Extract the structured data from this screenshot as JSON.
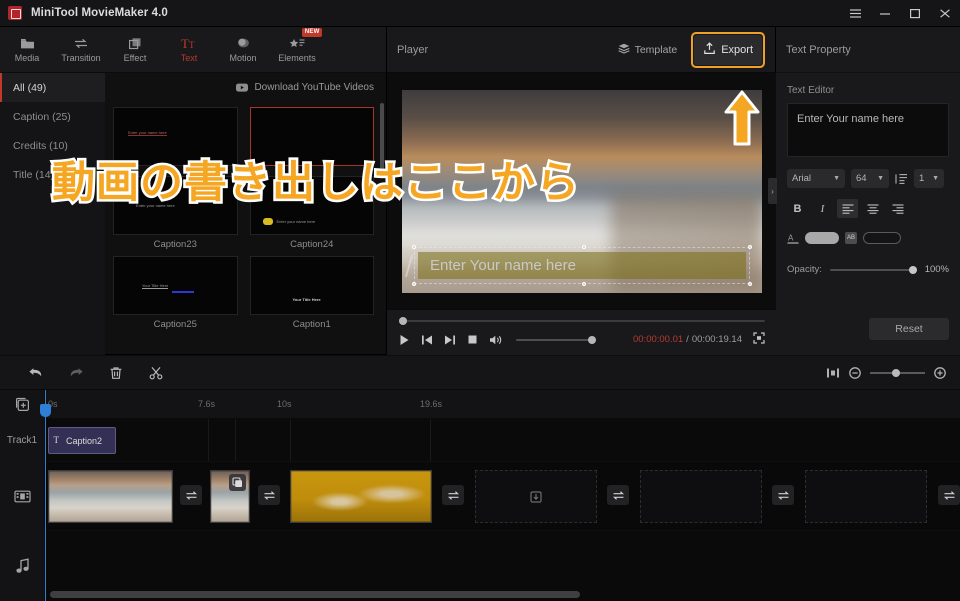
{
  "window": {
    "title": "MiniTool MovieMaker 4.0",
    "logo_icon": "app-logo-icon",
    "menu_icon": "hamburger-menu-icon",
    "minimize_icon": "minimize-icon",
    "maximize_icon": "maximize-icon",
    "close_icon": "close-icon"
  },
  "toolbar": {
    "items": [
      {
        "label": "Media",
        "icon": "media-folder-icon",
        "active": false,
        "badge": ""
      },
      {
        "label": "Transition",
        "icon": "transition-icon",
        "active": false,
        "badge": ""
      },
      {
        "label": "Effect",
        "icon": "effect-icon",
        "active": false,
        "badge": ""
      },
      {
        "label": "Text",
        "icon": "text-icon",
        "active": true,
        "badge": ""
      },
      {
        "label": "Motion",
        "icon": "motion-icon",
        "active": false,
        "badge": ""
      },
      {
        "label": "Elements",
        "icon": "elements-icon",
        "active": false,
        "badge": "NEW"
      }
    ]
  },
  "library": {
    "categories": [
      {
        "label": "All (49)",
        "selected": true
      },
      {
        "label": "Caption (25)",
        "selected": false
      },
      {
        "label": "Credits (10)",
        "selected": false
      },
      {
        "label": "Title (14)",
        "selected": false
      }
    ],
    "download_link": "Download YouTube Videos",
    "download_icon": "youtube-icon",
    "templates": [
      {
        "label": "",
        "preview_text": "Enter your name here",
        "selected": false
      },
      {
        "label": "",
        "preview_text": "",
        "selected": true
      },
      {
        "label": "Caption23",
        "preview_text": "Enter your name here",
        "selected": false
      },
      {
        "label": "Caption24",
        "preview_text": "Enter your name here",
        "selected": false
      },
      {
        "label": "Caption25",
        "preview_text": "Your Title Here",
        "selected": false
      },
      {
        "label": "Caption1",
        "preview_text": "Your  Title Here",
        "selected": false
      }
    ]
  },
  "player": {
    "title": "Player",
    "template_label": "Template",
    "template_icon": "layers-icon",
    "export_label": "Export",
    "export_icon": "export-upload-icon",
    "export_highlight_color": "#f0a02a",
    "overlay_text": "動画の書き出しはここから",
    "overlay_arrow": "up-arrow-annotation",
    "caption_text": "Enter Your name here",
    "controls": {
      "play_icon": "play-icon",
      "prev_icon": "previous-frame-icon",
      "next_icon": "next-frame-icon",
      "stop_icon": "stop-icon",
      "volume_icon": "volume-icon",
      "fullscreen_icon": "fullscreen-icon",
      "current_time": "00:00:00.01",
      "separator": "/",
      "total_time": "00:00:19.14"
    }
  },
  "properties": {
    "panel_title": "Text Property",
    "section_title": "Text Editor",
    "text_value": "Enter Your name here",
    "font_family": "Arial",
    "font_size": "64",
    "line_height": "1",
    "line_height_icon": "line-spacing-icon",
    "bold_label": "B",
    "italic_label": "I",
    "align_left_icon": "align-left-icon",
    "align_center_icon": "align-center-icon",
    "align_right_icon": "align-right-icon",
    "font_color_icon": "font-color-icon",
    "outline_color_icon": "outline-color-icon",
    "opacity_label": "Opacity:",
    "opacity_value": "100%",
    "reset_label": "Reset",
    "collapse_icon": "collapse-panel-icon"
  },
  "timeline": {
    "undo_icon": "undo-icon",
    "redo_icon": "redo-icon",
    "delete_icon": "trash-icon",
    "split_icon": "scissors-icon",
    "fit_icon": "fit-to-timeline-icon",
    "zoom_out_icon": "zoom-out-icon",
    "zoom_in_icon": "zoom-in-icon",
    "add_track_icon": "add-track-icon",
    "video_track_icon": "film-strip-icon",
    "audio_track_icon": "music-note-icon",
    "track_label": "Track1",
    "ruler_ticks": [
      "0s",
      "7.6s",
      "10s",
      "19.6s"
    ],
    "text_clip": {
      "label": "Caption2",
      "icon": "text-clip-icon"
    },
    "video_clips": [
      {
        "type": "beach",
        "has_overlay_badge": false
      },
      {
        "type": "beach",
        "has_overlay_badge": true
      },
      {
        "type": "duck",
        "has_overlay_badge": false
      },
      {
        "type": "empty",
        "has_overlay_badge": false
      },
      {
        "type": "empty",
        "has_overlay_badge": false
      },
      {
        "type": "empty",
        "has_overlay_badge": false
      },
      {
        "type": "empty",
        "has_overlay_badge": false
      }
    ],
    "transition_icon": "transition-arrows-icon"
  }
}
